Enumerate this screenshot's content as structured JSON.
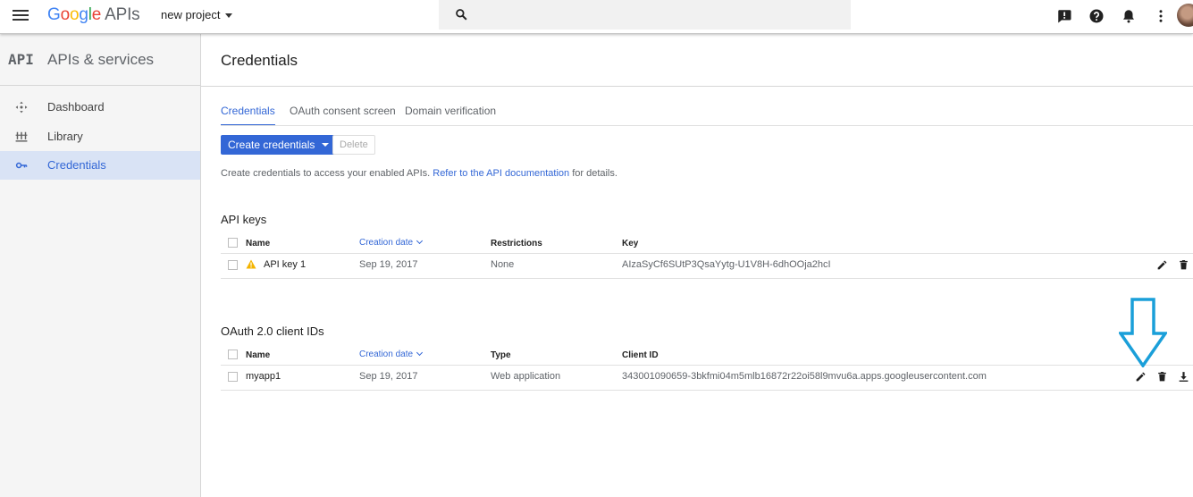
{
  "header": {
    "logo": {
      "g1": "G",
      "g2": "o",
      "g3": "o",
      "g4": "g",
      "g5": "l",
      "g6": "e",
      "apis": "APIs"
    },
    "project": "new project",
    "search_placeholder": "",
    "icons": [
      "menu-icon",
      "search-icon",
      "feedback-icon",
      "help-icon",
      "notifications-icon",
      "more-vert-icon",
      "avatar"
    ]
  },
  "sidebar": {
    "mark": "API",
    "title": "APIs & services",
    "items": [
      {
        "label": "Dashboard",
        "icon": "dashboard-icon"
      },
      {
        "label": "Library",
        "icon": "library-icon"
      },
      {
        "label": "Credentials",
        "icon": "key-icon",
        "active": true
      }
    ]
  },
  "main": {
    "title": "Credentials",
    "tabs": [
      {
        "label": "Credentials",
        "active": true
      },
      {
        "label": "OAuth consent screen"
      },
      {
        "label": "Domain verification"
      }
    ],
    "create_button": "Create credentials",
    "delete_button": "Delete",
    "info_text": "Create credentials to access your enabled APIs.",
    "info_link": "Refer to the API documentation",
    "info_suffix": "for details."
  },
  "api_keys": {
    "title": "API keys",
    "columns": [
      "Name",
      "Creation date",
      "Restrictions",
      "Key"
    ],
    "rows": [
      {
        "name": "API key 1",
        "date": "Sep 19, 2017",
        "restrictions": "None",
        "key": "AIzaSyCf6SUtP3QsaYytg-U1V8H-6dhOOja2hcI",
        "warning": true
      }
    ]
  },
  "oauth": {
    "title": "OAuth 2.0 client IDs",
    "columns": [
      "Name",
      "Creation date",
      "Type",
      "Client ID"
    ],
    "rows": [
      {
        "name": "myapp1",
        "date": "Sep 19, 2017",
        "type": "Web application",
        "client_id": "343001090659-3bkfmi04m5mlb16872r22oi58l9mvu6a.apps.googleusercontent.com"
      }
    ]
  },
  "colors": {
    "accent": "#3367d6",
    "annotation_arrow": "#1a9fd9",
    "warning": "#f4b400"
  }
}
